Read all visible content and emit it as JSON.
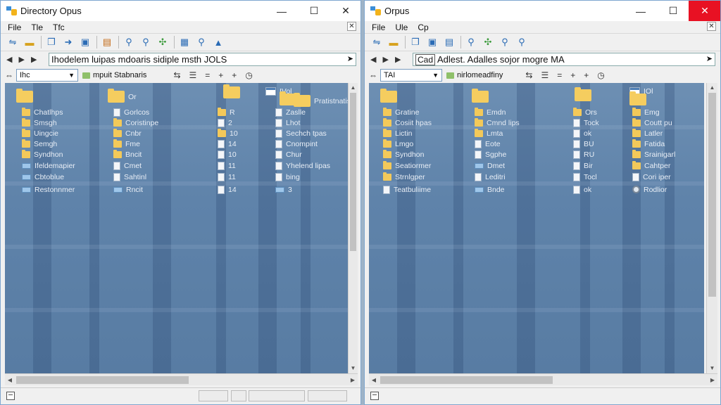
{
  "left": {
    "title": "Directory Opus",
    "menu": [
      "File",
      "Tle",
      "Tfc"
    ],
    "window_controls": {
      "minimize": "—",
      "maximize": "☐",
      "close": "✕",
      "menu_close": "✕"
    },
    "toolbar_icons": [
      "back-split-icon",
      "folder-icon",
      "copy-icon",
      "move-icon",
      "save-icon",
      "archive-icon",
      "search-icon",
      "find-icon",
      "network-icon",
      "grid-icon",
      "zoom-icon",
      "upload-icon"
    ],
    "path": "Ihodelem luipas mdoaris sidiple msth JOLS",
    "nav_arrows": [
      "◀",
      "▶",
      "▶"
    ],
    "filter_combo": "Ihc",
    "folder_tab": "mpuit Stabnaris",
    "items": [
      {
        "label": "",
        "icon": "bigfolder"
      },
      {
        "label": "Or",
        "icon": "bigfolder"
      },
      {
        "label": "",
        "icon": "bigfolder"
      },
      {
        "label": "IVol",
        "icon": "window"
      },
      {
        "label": "",
        "icon": "bigfolder"
      },
      {
        "label": "Pratistnatis",
        "icon": "bigfolder"
      },
      {
        "label": "Chatlhps",
        "icon": "folder"
      },
      {
        "label": "Gorlcos",
        "icon": "doc"
      },
      {
        "label": "R",
        "icon": "folder"
      },
      {
        "label": "Zaslle",
        "icon": "doc"
      },
      {
        "label": "Smsgh",
        "icon": "folder"
      },
      {
        "label": "Coristinpe",
        "icon": "folder"
      },
      {
        "label": "2",
        "icon": "doc"
      },
      {
        "label": "Lhot",
        "icon": "doc"
      },
      {
        "label": "Uingcie",
        "icon": "folder"
      },
      {
        "label": "Cnbr",
        "icon": "folder"
      },
      {
        "label": "10",
        "icon": "folder"
      },
      {
        "label": "Sechch tpas",
        "icon": "doc"
      },
      {
        "label": "Semgh",
        "icon": "folder"
      },
      {
        "label": "Fme",
        "icon": "folder"
      },
      {
        "label": "14",
        "icon": "doc"
      },
      {
        "label": "Cnompint",
        "icon": "doc"
      },
      {
        "label": "Syndhon",
        "icon": "folder"
      },
      {
        "label": "Bncit",
        "icon": "folder"
      },
      {
        "label": "10",
        "icon": "doc"
      },
      {
        "label": "Chur",
        "icon": "doc"
      },
      {
        "label": "Ifeldemapier",
        "icon": "flat"
      },
      {
        "label": "Cmet",
        "icon": "doc"
      },
      {
        "label": "11",
        "icon": "doc"
      },
      {
        "label": "Yhelend lipas",
        "icon": "doc"
      },
      {
        "label": "Cbtoblue",
        "icon": "flat"
      },
      {
        "label": "Sahtinl",
        "icon": "doc"
      },
      {
        "label": "11",
        "icon": "doc"
      },
      {
        "label": "bing",
        "icon": "doc"
      },
      {
        "label": "Restonnmer",
        "icon": "flat"
      },
      {
        "label": "Rncit",
        "icon": "flat"
      },
      {
        "label": "14",
        "icon": "doc"
      },
      {
        "label": "3",
        "icon": "flat"
      }
    ]
  },
  "right": {
    "title": "Orpus",
    "menu": [
      "File",
      "Ule",
      "Cp"
    ],
    "window_controls": {
      "minimize": "—",
      "maximize": "☐",
      "close": "✕",
      "menu_close": "✕"
    },
    "toolbar_icons": [
      "back-split-icon",
      "folder-icon",
      "copy-icon",
      "move-icon",
      "save-icon",
      "search-icon",
      "network-icon",
      "find-icon",
      "zoom-icon"
    ],
    "path": "Adlest. Adalles sojor mogre MA",
    "path_prefix": "Cad",
    "nav_arrows": [
      "◀",
      "▶",
      "▶"
    ],
    "filter_combo": "TAI",
    "folder_tab": "nirlomeadfiny",
    "items": [
      {
        "label": "",
        "icon": "bigfolder"
      },
      {
        "label": "",
        "icon": "bigfolder"
      },
      {
        "label": "",
        "icon": "bigfolder"
      },
      {
        "label": "IOl",
        "icon": "window"
      },
      {
        "label": "",
        "icon": "bigfolder"
      },
      {
        "label": "Gratine",
        "icon": "folder"
      },
      {
        "label": "Emdn",
        "icon": "folder"
      },
      {
        "label": "Ors",
        "icon": "folder"
      },
      {
        "label": "Emg",
        "icon": "folder"
      },
      {
        "label": "Cosiit hpas",
        "icon": "folder"
      },
      {
        "label": "Cmnd lips",
        "icon": "folder"
      },
      {
        "label": "Tock",
        "icon": "doc"
      },
      {
        "label": "Coutt pu",
        "icon": "folder"
      },
      {
        "label": "Lictin",
        "icon": "folder"
      },
      {
        "label": "Lmta",
        "icon": "folder"
      },
      {
        "label": "ok",
        "icon": "doc"
      },
      {
        "label": "Latler",
        "icon": "folder"
      },
      {
        "label": "Lmgo",
        "icon": "folder"
      },
      {
        "label": "Eote",
        "icon": "doc"
      },
      {
        "label": "BU",
        "icon": "doc"
      },
      {
        "label": "Fatida",
        "icon": "folder"
      },
      {
        "label": "Syndhon",
        "icon": "folder"
      },
      {
        "label": "Sgphe",
        "icon": "doc"
      },
      {
        "label": "RU",
        "icon": "doc"
      },
      {
        "label": "Srainigarl",
        "icon": "folder"
      },
      {
        "label": "Seatiormer",
        "icon": "folder"
      },
      {
        "label": "Dmet",
        "icon": "flat"
      },
      {
        "label": "Bir",
        "icon": "doc"
      },
      {
        "label": "Cahtper",
        "icon": "folder"
      },
      {
        "label": "Strnlgper",
        "icon": "folder"
      },
      {
        "label": "Leditri",
        "icon": "doc"
      },
      {
        "label": "Tocl",
        "icon": "doc"
      },
      {
        "label": "Cori iper",
        "icon": "doc"
      },
      {
        "label": "Teatbuliime",
        "icon": "doc"
      },
      {
        "label": "Bnde",
        "icon": "flat"
      },
      {
        "label": "ok",
        "icon": "doc"
      },
      {
        "label": "Rodlior",
        "icon": "gear"
      }
    ]
  }
}
